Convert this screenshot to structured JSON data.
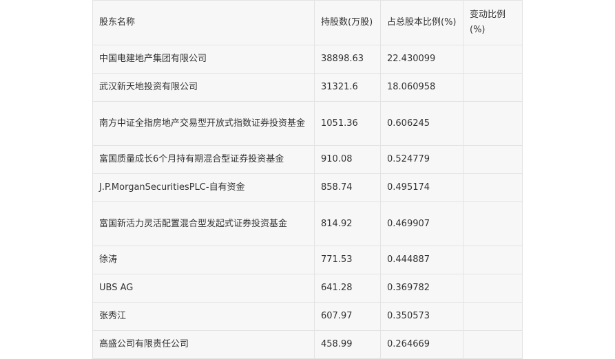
{
  "table": {
    "headers": [
      "股东名称",
      "持股数(万股)",
      "占总股本比例(%)",
      "变动比例(%)"
    ],
    "rows": [
      [
        "中国电建地产集团有限公司",
        "38898.63",
        "22.430099",
        ""
      ],
      [
        "武汉新天地投资有限公司",
        "31321.6",
        "18.060958",
        ""
      ],
      [
        "南方中证全指房地产交易型开放式指数证券投资基金",
        "1051.36",
        "0.606245",
        ""
      ],
      [
        "富国质量成长6个月持有期混合型证券投资基金",
        "910.08",
        "0.524779",
        ""
      ],
      [
        "J.P.MorganSecuritiesPLC-自有资金",
        "858.74",
        "0.495174",
        ""
      ],
      [
        "富国新活力灵活配置混合型发起式证券投资基金",
        "814.92",
        "0.469907",
        ""
      ],
      [
        "徐涛",
        "771.53",
        "0.444887",
        ""
      ],
      [
        "UBS AG",
        "641.28",
        "0.369782",
        ""
      ],
      [
        "张秀江",
        "607.97",
        "0.350573",
        ""
      ],
      [
        "高盛公司有限责任公司",
        "458.99",
        "0.264669",
        ""
      ]
    ]
  }
}
